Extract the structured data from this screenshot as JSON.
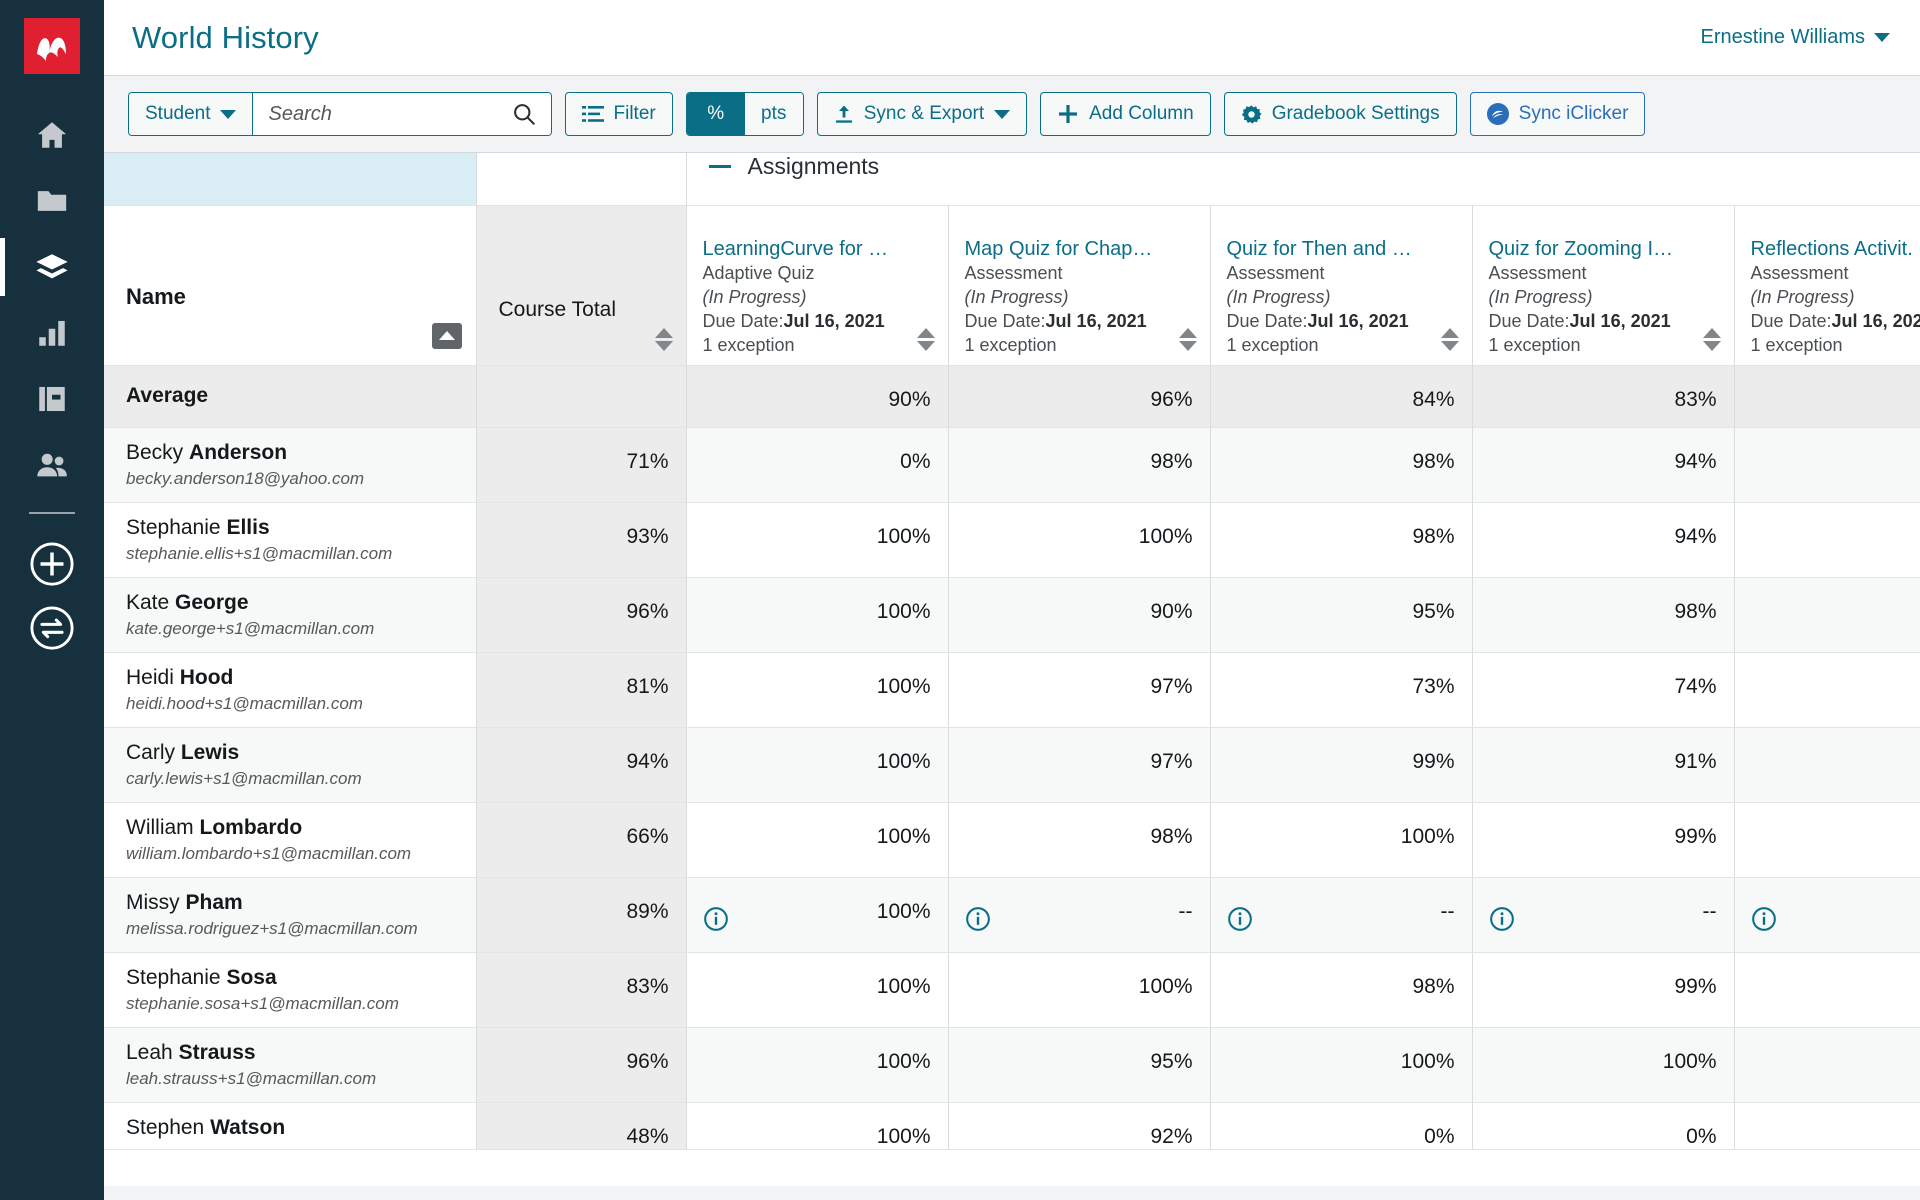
{
  "header": {
    "course_title": "World History",
    "user_name": "Ernestine Williams"
  },
  "toolbar": {
    "student_dropdown_label": "Student",
    "search_placeholder": "Search",
    "search_value": "",
    "filter_label": "Filter",
    "toggle_percent": "%",
    "toggle_points": "pts",
    "toggle_selected": "%",
    "sync_export_label": "Sync & Export",
    "add_column_label": "Add Column",
    "gradebook_settings_label": "Gradebook Settings",
    "sync_iclicker_label": "Sync iClicker",
    "accent_teal": "#0b6e87",
    "accent_blue": "#2a6ebb",
    "logo_red": "#e02030"
  },
  "sidebar": {
    "items": [
      {
        "icon": "home-icon",
        "active": false
      },
      {
        "icon": "folder-icon",
        "active": false
      },
      {
        "icon": "gradebook-layers-icon",
        "active": true
      },
      {
        "icon": "bar-chart-icon",
        "active": false
      },
      {
        "icon": "book-icon",
        "active": false
      },
      {
        "icon": "people-icon",
        "active": false
      }
    ],
    "round_items": [
      {
        "icon": "plus-circle-icon"
      },
      {
        "icon": "swap-circle-icon"
      }
    ]
  },
  "grid": {
    "group_header": "Assignments",
    "name_column_header": "Name",
    "total_column_header": "Course Total",
    "average_row_label": "Average",
    "assignments": [
      {
        "title": "LearningCurve for …",
        "type": "Adaptive Quiz",
        "status": "(In Progress)",
        "due_label": "Due Date:",
        "due_date": "Jul 16, 2021",
        "exceptions": "1 exception"
      },
      {
        "title": "Map Quiz for Chap…",
        "type": "Assessment",
        "status": "(In Progress)",
        "due_label": "Due Date:",
        "due_date": "Jul 16, 2021",
        "exceptions": "1 exception"
      },
      {
        "title": "Quiz for Then and …",
        "type": "Assessment",
        "status": "(In Progress)",
        "due_label": "Due Date:",
        "due_date": "Jul 16, 2021",
        "exceptions": "1 exception"
      },
      {
        "title": "Quiz for Zooming I…",
        "type": "Assessment",
        "status": "(In Progress)",
        "due_label": "Due Date:",
        "due_date": "Jul 16, 2021",
        "exceptions": "1 exception"
      },
      {
        "title": "Reflections Activit.",
        "type": "Assessment",
        "status": "(In Progress)",
        "due_label": "Due Date:",
        "due_date": "Jul 16, 202",
        "exceptions": "1 exception"
      }
    ],
    "average_row": {
      "course_total": "",
      "values": [
        "90%",
        "96%",
        "84%",
        "83%",
        ""
      ]
    },
    "rows": [
      {
        "first_name": "Becky",
        "last_name": "Anderson",
        "email": "becky.anderson18@yahoo.com",
        "course_total": "71%",
        "values": [
          "0%",
          "98%",
          "98%",
          "94%",
          ""
        ],
        "info_flags": [
          false,
          false,
          false,
          false,
          false
        ]
      },
      {
        "first_name": "Stephanie",
        "last_name": "Ellis",
        "email": "stephanie.ellis+s1@macmillan.com",
        "course_total": "93%",
        "values": [
          "100%",
          "100%",
          "98%",
          "94%",
          ""
        ],
        "info_flags": [
          false,
          false,
          false,
          false,
          false
        ]
      },
      {
        "first_name": "Kate",
        "last_name": "George",
        "email": "kate.george+s1@macmillan.com",
        "course_total": "96%",
        "values": [
          "100%",
          "90%",
          "95%",
          "98%",
          ""
        ],
        "info_flags": [
          false,
          false,
          false,
          false,
          false
        ]
      },
      {
        "first_name": "Heidi",
        "last_name": "Hood",
        "email": "heidi.hood+s1@macmillan.com",
        "course_total": "81%",
        "values": [
          "100%",
          "97%",
          "73%",
          "74%",
          ""
        ],
        "info_flags": [
          false,
          false,
          false,
          false,
          false
        ]
      },
      {
        "first_name": "Carly",
        "last_name": "Lewis",
        "email": "carly.lewis+s1@macmillan.com",
        "course_total": "94%",
        "values": [
          "100%",
          "97%",
          "99%",
          "91%",
          ""
        ],
        "info_flags": [
          false,
          false,
          false,
          false,
          false
        ]
      },
      {
        "first_name": "William",
        "last_name": "Lombardo",
        "email": "william.lombardo+s1@macmillan.com",
        "course_total": "66%",
        "values": [
          "100%",
          "98%",
          "100%",
          "99%",
          ""
        ],
        "info_flags": [
          false,
          false,
          false,
          false,
          false
        ]
      },
      {
        "first_name": "Missy",
        "last_name": "Pham",
        "email": "melissa.rodriguez+s1@macmillan.com",
        "course_total": "89%",
        "values": [
          "100%",
          "--",
          "--",
          "--",
          ""
        ],
        "info_flags": [
          true,
          true,
          true,
          true,
          true
        ]
      },
      {
        "first_name": "Stephanie",
        "last_name": "Sosa",
        "email": "stephanie.sosa+s1@macmillan.com",
        "course_total": "83%",
        "values": [
          "100%",
          "100%",
          "98%",
          "99%",
          ""
        ],
        "info_flags": [
          false,
          false,
          false,
          false,
          false
        ]
      },
      {
        "first_name": "Leah",
        "last_name": "Strauss",
        "email": "leah.strauss+s1@macmillan.com",
        "course_total": "96%",
        "values": [
          "100%",
          "95%",
          "100%",
          "100%",
          ""
        ],
        "info_flags": [
          false,
          false,
          false,
          false,
          false
        ]
      },
      {
        "first_name": "Stephen",
        "last_name": "Watson",
        "email": "",
        "course_total": "48%",
        "values": [
          "100%",
          "92%",
          "0%",
          "0%",
          ""
        ],
        "info_flags": [
          false,
          false,
          false,
          false,
          false
        ]
      }
    ]
  }
}
